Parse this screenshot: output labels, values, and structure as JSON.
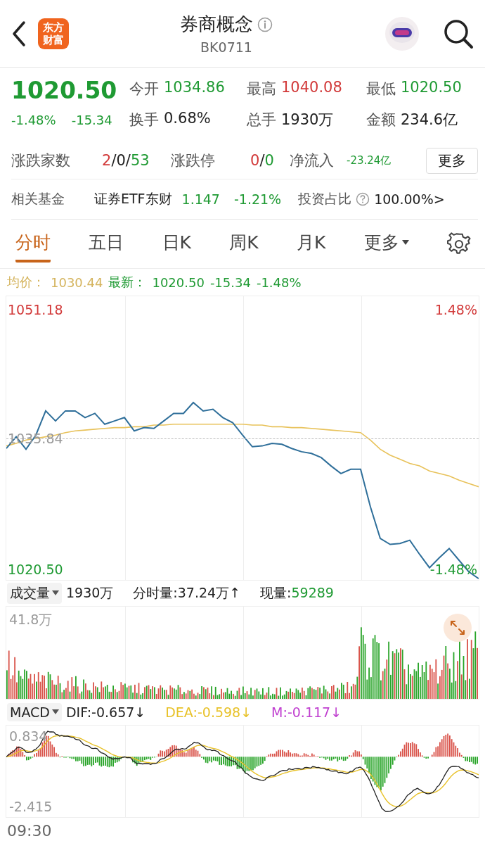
{
  "header": {
    "logo": [
      "东方",
      "财富"
    ],
    "title": "券商概念",
    "code": "BK0711"
  },
  "quote": {
    "price": "1020.50",
    "color": "#1f9a33",
    "change_pct": "-1.48%",
    "change": "-15.34",
    "stats": [
      {
        "label": "今开",
        "value": "1034.86",
        "color": "#1f9a33"
      },
      {
        "label": "最高",
        "value": "1040.08",
        "color": "#d23a3a"
      },
      {
        "label": "最低",
        "value": "1020.50",
        "color": "#1f9a33"
      },
      {
        "label": "换手",
        "value": "0.68%",
        "color": "#222222"
      },
      {
        "label": "总手",
        "value": "1930万",
        "color": "#222222"
      },
      {
        "label": "金额",
        "value": "234.6亿",
        "color": "#222222"
      }
    ],
    "breadth": [
      {
        "label": "涨跌家数",
        "kind": "normal",
        "parts": [
          {
            "text": "2",
            "color": "#d23a3a"
          },
          {
            "text": "/0/",
            "color": "#222222"
          },
          {
            "text": "53",
            "color": "#1f9a33"
          }
        ]
      },
      {
        "label": "涨跌停",
        "kind": "normal",
        "parts": [
          {
            "text": "0",
            "color": "#d23a3a"
          },
          {
            "text": "/",
            "color": "#222222"
          },
          {
            "text": "0",
            "color": "#1f9a33"
          }
        ]
      },
      {
        "label": "净流入",
        "kind": "small",
        "parts": [
          {
            "text": "-23.24亿",
            "color": "#1f9a33"
          }
        ]
      }
    ],
    "more_button": "更多"
  },
  "fund": {
    "label": "相关基金",
    "name": "证券ETF东财",
    "price": "1.147",
    "change": "-1.21%",
    "color": "#1f9a33",
    "ratio_label": "投资占比",
    "ratio": "100.00%",
    "arrow": ">"
  },
  "tabs": [
    {
      "label": "分时",
      "kind": "tab",
      "selected": true
    },
    {
      "label": "五日",
      "kind": "tab",
      "selected": false
    },
    {
      "label": "日K",
      "kind": "tab",
      "selected": false
    },
    {
      "label": "周K",
      "kind": "tab",
      "selected": false
    },
    {
      "label": "月K",
      "kind": "tab",
      "selected": false
    },
    {
      "label": "更多",
      "kind": "dropdown",
      "selected": false
    }
  ],
  "legend": {
    "avg": "1030.44",
    "latest": "1020.50",
    "change": "-15.34",
    "change_pct": "-1.48%"
  },
  "price_chart": {
    "max_pct": "1.48%",
    "min_pct": "-1.48%",
    "chart_data": {
      "type": "line",
      "ylim": [
        1018.84,
        1052.84
      ],
      "yticks": [
        {
          "value": 1051.18,
          "label": "1051.18"
        },
        {
          "value": 1035.84,
          "label": "1035.84"
        },
        {
          "value": 1020.5,
          "label": "1020.50"
        }
      ],
      "series": [
        {
          "name": "均价：",
          "color": "#e8c25a",
          "values": [
            1034.9,
            1035.2,
            1035.6,
            1035.8,
            1036.0,
            1036.2,
            1036.5,
            1036.7,
            1036.8,
            1036.9,
            1037.0,
            1037.1,
            1037.1,
            1037.2,
            1037.2,
            1037.4,
            1037.4,
            1037.5,
            1037.5,
            1037.5,
            1037.5,
            1037.5,
            1037.5,
            1037.5,
            1037.5,
            1037.4,
            1037.4,
            1037.2,
            1037.2,
            1037.1,
            1037.1,
            1037.0,
            1036.9,
            1036.8,
            1036.7,
            1036.6,
            1036.5,
            1035.6,
            1034.5,
            1033.8,
            1033.3,
            1032.8,
            1032.5,
            1031.9,
            1031.6,
            1031.3,
            1030.8,
            1030.4,
            1030.0
          ]
        },
        {
          "name": "最新：",
          "color": "#2f6f9a",
          "values": [
            1034.6,
            1036.0,
            1034.5,
            1036.2,
            1039.1,
            1037.9,
            1039.1,
            1039.1,
            1038.3,
            1038.8,
            1037.5,
            1037.9,
            1038.3,
            1036.7,
            1037.1,
            1037.0,
            1037.9,
            1038.8,
            1038.8,
            1040.1,
            1039.1,
            1039.3,
            1038.3,
            1037.7,
            1036.2,
            1034.8,
            1034.9,
            1035.2,
            1035.1,
            1034.6,
            1034.2,
            1034.0,
            1033.5,
            1032.5,
            1031.6,
            1032.1,
            1032.1,
            1027.6,
            1023.8,
            1023.1,
            1023.2,
            1023.6,
            1021.9,
            1020.3,
            1021.5,
            1022.6,
            1021.2,
            1019.8,
            1019.0
          ]
        }
      ]
    }
  },
  "volume": {
    "selector": "成交量",
    "total": "1930万",
    "interval": "分时量:37.24万↑",
    "current_label": "现量:",
    "current": "59289",
    "axis_max": "41.8万"
  },
  "macd": {
    "selector": "MACD",
    "dif": "DIF:-0.657↓",
    "dea": "DEA:-0.598↓",
    "m": "M:-0.117↓",
    "axis_max": "0.834",
    "axis_min": "-2.415"
  },
  "time_axis": {
    "start": "09:30"
  }
}
